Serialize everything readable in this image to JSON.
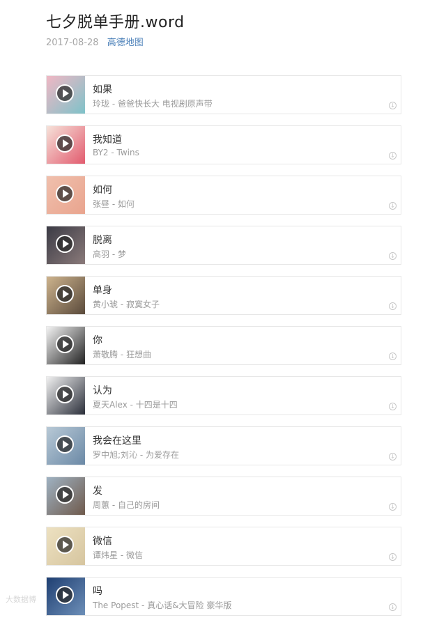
{
  "header": {
    "title": "七夕脱单手册.word",
    "date": "2017-08-28",
    "location_link": "高德地图"
  },
  "playlist": [
    {
      "song": "如果",
      "artist": "玲珑 - 爸爸快长大 电视剧原声带",
      "cover_colors": [
        "#f0b7c4",
        "#7ec2c9"
      ]
    },
    {
      "song": "我知道",
      "artist": "BY2 - Twins",
      "cover_colors": [
        "#f6e2da",
        "#e25b6e"
      ]
    },
    {
      "song": "如何",
      "artist": "张昼 - 如何",
      "cover_colors": [
        "#f0c0ad",
        "#e9a48e"
      ]
    },
    {
      "song": "脱离",
      "artist": "高羽 - 梦",
      "cover_colors": [
        "#3b3b45",
        "#8a7a7a"
      ]
    },
    {
      "song": "单身",
      "artist": "黄小琥 - 寂寞女子",
      "cover_colors": [
        "#cdb38d",
        "#5a4a3b"
      ]
    },
    {
      "song": "你",
      "artist": "萧敬腾 - 狂想曲",
      "cover_colors": [
        "#f4f4f4",
        "#222222"
      ]
    },
    {
      "song": "认为",
      "artist": "夏天Alex - 十四是十四",
      "cover_colors": [
        "#f1f1f1",
        "#2b2f3a"
      ]
    },
    {
      "song": "我会在这里",
      "artist": "罗中旭;刘沁 - 为爱存在",
      "cover_colors": [
        "#b8c9d6",
        "#6b89a6"
      ]
    },
    {
      "song": "发",
      "artist": "周蕙 - 自己的房间",
      "cover_colors": [
        "#9fb2c2",
        "#6f5a4c"
      ]
    },
    {
      "song": "微信",
      "artist": "谭炜星 - 微信",
      "cover_colors": [
        "#ede1c1",
        "#d6c59f"
      ]
    },
    {
      "song": "吗",
      "artist": "The Popest - 真心话&大冒险 豪华版",
      "cover_colors": [
        "#1f3f72",
        "#6d8fb8"
      ]
    }
  ],
  "watermark": "大数据博"
}
